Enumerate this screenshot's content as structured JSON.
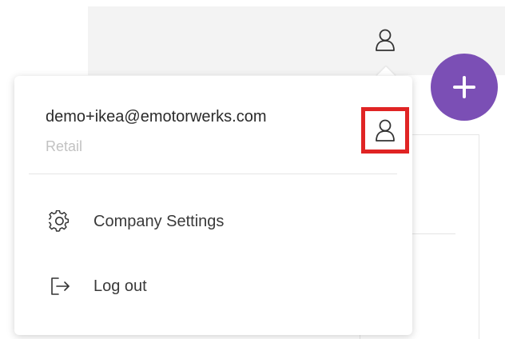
{
  "header": {
    "user_icon": "user-icon"
  },
  "fab": {
    "icon": "plus-icon",
    "color": "#7b4fb5"
  },
  "user_menu": {
    "email": "demo+ikea@emotorwerks.com",
    "role": "Retail",
    "profile_icon": "user-icon",
    "highlight_color": "#e02424",
    "items": [
      {
        "label": "Company Settings",
        "icon": "gear-icon"
      },
      {
        "label": "Log out",
        "icon": "logout-icon"
      }
    ]
  }
}
